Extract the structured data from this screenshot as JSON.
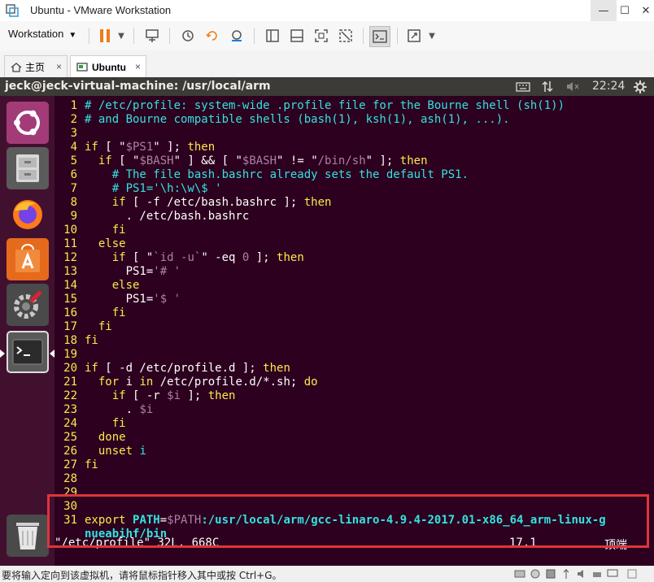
{
  "window": {
    "title": "Ubuntu - VMware Workstation",
    "min": "—",
    "max": "☐",
    "close": "✕"
  },
  "toolbar": {
    "workstation_label": "Workstation",
    "caret": "▼"
  },
  "tabs": [
    {
      "label": "主页",
      "close": "×",
      "icon": "home-icon"
    },
    {
      "label": "Ubuntu",
      "close": "×",
      "icon": "vm-icon"
    }
  ],
  "ubuntu": {
    "terminal_title": "jeck@jeck-virtual-machine: /usr/local/arm",
    "clock": "22:24"
  },
  "editor": {
    "lines": [
      {
        "n": "1",
        "parts": [
          [
            "c",
            "# /etc/profile: system-wide .profile file for the Bourne shell (sh(1))"
          ]
        ]
      },
      {
        "n": "2",
        "parts": [
          [
            "c",
            "# and Bourne compatible shells (bash(1), ksh(1), ash(1), ...)."
          ]
        ]
      },
      {
        "n": "3",
        "parts": []
      },
      {
        "n": "4",
        "parts": [
          [
            "k",
            "if"
          ],
          [
            "t",
            " [ \""
          ],
          [
            "s",
            "$PS1"
          ],
          [
            "t",
            "\" ]; "
          ],
          [
            "k",
            "then"
          ]
        ]
      },
      {
        "n": "5",
        "parts": [
          [
            "t",
            "  "
          ],
          [
            "k",
            "if"
          ],
          [
            "t",
            " [ \""
          ],
          [
            "s",
            "$BASH"
          ],
          [
            "t",
            "\" ] && [ \""
          ],
          [
            "s",
            "$BASH"
          ],
          [
            "t",
            "\" != \""
          ],
          [
            "s",
            "/bin/sh"
          ],
          [
            "t",
            "\" ]; "
          ],
          [
            "k",
            "then"
          ]
        ]
      },
      {
        "n": "6",
        "parts": [
          [
            "t",
            "    "
          ],
          [
            "c",
            "# The file bash.bashrc already sets the default PS1."
          ]
        ]
      },
      {
        "n": "7",
        "parts": [
          [
            "t",
            "    "
          ],
          [
            "c",
            "# PS1='\\h:\\w\\$ '"
          ]
        ]
      },
      {
        "n": "8",
        "parts": [
          [
            "t",
            "    "
          ],
          [
            "k",
            "if"
          ],
          [
            "t",
            " [ -f /etc/bash.bashrc ]; "
          ],
          [
            "k",
            "then"
          ]
        ]
      },
      {
        "n": "9",
        "parts": [
          [
            "t",
            "      . /etc/bash.bashrc"
          ]
        ]
      },
      {
        "n": "10",
        "parts": [
          [
            "t",
            "    "
          ],
          [
            "k",
            "fi"
          ]
        ]
      },
      {
        "n": "11",
        "parts": [
          [
            "t",
            "  "
          ],
          [
            "k",
            "else"
          ]
        ]
      },
      {
        "n": "12",
        "parts": [
          [
            "t",
            "    "
          ],
          [
            "k",
            "if"
          ],
          [
            "t",
            " [ \""
          ],
          [
            "s",
            "`id -u`"
          ],
          [
            "t",
            "\" -eq "
          ],
          [
            "s",
            "0"
          ],
          [
            "t",
            " ]; "
          ],
          [
            "k",
            "then"
          ]
        ]
      },
      {
        "n": "13",
        "parts": [
          [
            "t",
            "      PS1="
          ],
          [
            "s",
            "'# '"
          ]
        ]
      },
      {
        "n": "14",
        "parts": [
          [
            "t",
            "    "
          ],
          [
            "k",
            "else"
          ]
        ]
      },
      {
        "n": "15",
        "parts": [
          [
            "t",
            "      PS1="
          ],
          [
            "s",
            "'$ '"
          ]
        ]
      },
      {
        "n": "16",
        "parts": [
          [
            "t",
            "    "
          ],
          [
            "k",
            "fi"
          ]
        ]
      },
      {
        "n": "17",
        "parts": [
          [
            "t",
            "  "
          ],
          [
            "k",
            "fi"
          ]
        ]
      },
      {
        "n": "18",
        "parts": [
          [
            "k",
            "fi"
          ]
        ]
      },
      {
        "n": "19",
        "parts": []
      },
      {
        "n": "20",
        "parts": [
          [
            "k",
            "if"
          ],
          [
            "t",
            " [ -d /etc/profile.d ]; "
          ],
          [
            "k",
            "then"
          ]
        ]
      },
      {
        "n": "21",
        "parts": [
          [
            "t",
            "  "
          ],
          [
            "k",
            "for"
          ],
          [
            "t",
            " i "
          ],
          [
            "k",
            "in"
          ],
          [
            "t",
            " /etc/profile.d/*.sh; "
          ],
          [
            "k",
            "do"
          ]
        ]
      },
      {
        "n": "22",
        "parts": [
          [
            "t",
            "    "
          ],
          [
            "k",
            "if"
          ],
          [
            "t",
            " [ -r "
          ],
          [
            "s",
            "$i"
          ],
          [
            "t",
            " ]; "
          ],
          [
            "k",
            "then"
          ]
        ]
      },
      {
        "n": "23",
        "parts": [
          [
            "t",
            "      . "
          ],
          [
            "s",
            "$i"
          ]
        ]
      },
      {
        "n": "24",
        "parts": [
          [
            "t",
            "    "
          ],
          [
            "k",
            "fi"
          ]
        ]
      },
      {
        "n": "25",
        "parts": [
          [
            "t",
            "  "
          ],
          [
            "k",
            "done"
          ]
        ]
      },
      {
        "n": "26",
        "parts": [
          [
            "t",
            "  "
          ],
          [
            "k",
            "unset"
          ],
          [
            "t",
            " "
          ],
          [
            "c",
            "i"
          ]
        ]
      },
      {
        "n": "27",
        "parts": [
          [
            "k",
            "fi"
          ]
        ]
      },
      {
        "n": "28",
        "parts": []
      },
      {
        "n": "29",
        "parts": []
      },
      {
        "n": "30",
        "parts": []
      },
      {
        "n": "31",
        "parts": [
          [
            "k",
            "export"
          ],
          [
            "t",
            " "
          ],
          [
            "b",
            "PATH"
          ],
          [
            "t",
            "="
          ],
          [
            "s",
            "$PATH"
          ],
          [
            "b",
            ":/usr/local/arm/gcc-linaro-4.9.4-2017.01-x86_64_arm-linux-g"
          ]
        ]
      },
      {
        "n": "",
        "parts": [
          [
            "b",
            "nueabihf/bin"
          ]
        ]
      }
    ],
    "status_file": "\"/etc/profile\" 32L, 668C",
    "status_pos": "17,1",
    "status_scroll": "顶端"
  },
  "statusbar": {
    "text": "要将输入定向到该虚拟机，请将鼠标指针移入其中或按 Ctrl+G。"
  },
  "colors": {
    "terminal_bg": "#2c001e",
    "launcher_bg": "#42102f",
    "highlight": "#e0343a",
    "line_number": "#fce94f"
  }
}
